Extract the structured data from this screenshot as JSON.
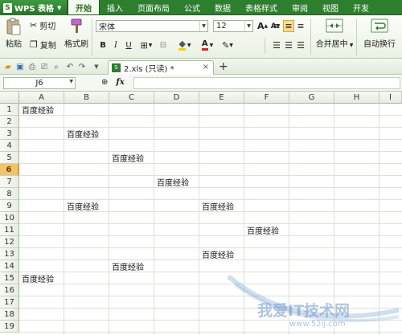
{
  "app": {
    "logo_glyph": "S",
    "name": "WPS 表格",
    "menu_tabs": [
      "开始",
      "插入",
      "页面布局",
      "公式",
      "数据",
      "表格样式",
      "审阅",
      "视图",
      "开发"
    ]
  },
  "ribbon": {
    "paste_label": "粘贴",
    "cut_label": "剪切",
    "copy_label": "复制",
    "format_painter_label": "格式刷",
    "font_name": "宋体",
    "font_size": "12",
    "grow_font": "A",
    "shrink_font": "A",
    "bold": "B",
    "italic": "I",
    "underline": "U",
    "font_color_glyph": "A",
    "merge_label": "合并居中",
    "wrap_label": "自动换行"
  },
  "doc": {
    "tab_title": "2.xls (只读) *",
    "close_glyph": "×",
    "add_glyph": "+"
  },
  "formula_bar": {
    "name_box": "J6",
    "fx_label": "fx",
    "zoom_glyph": "⊕",
    "formula_value": ""
  },
  "sheet": {
    "columns": [
      "A",
      "B",
      "C",
      "D",
      "E",
      "F",
      "G",
      "H",
      "I"
    ],
    "rows": [
      "1",
      "2",
      "3",
      "4",
      "5",
      "6",
      "7",
      "8",
      "9",
      "10",
      "11",
      "12",
      "13",
      "14",
      "15",
      "16",
      "17",
      "18",
      "19"
    ],
    "active_row": "6",
    "cells": [
      {
        "ref": "A1",
        "value": "百度经验"
      },
      {
        "ref": "B3",
        "value": "百度经验"
      },
      {
        "ref": "C5",
        "value": "百度经验"
      },
      {
        "ref": "D7",
        "value": "百度经验"
      },
      {
        "ref": "B9",
        "value": "百度经验"
      },
      {
        "ref": "E9",
        "value": "百度经验"
      },
      {
        "ref": "F11",
        "value": "百度经验"
      },
      {
        "ref": "E13",
        "value": "百度经验"
      },
      {
        "ref": "C14",
        "value": "百度经验"
      },
      {
        "ref": "A15",
        "value": "百度经验"
      }
    ]
  },
  "watermark": {
    "text": "我爱IT技术网",
    "url": "www.52ij.com"
  },
  "colors": {
    "menu_green": "#2d7f2d",
    "active_row_header": "#f3c56a"
  }
}
